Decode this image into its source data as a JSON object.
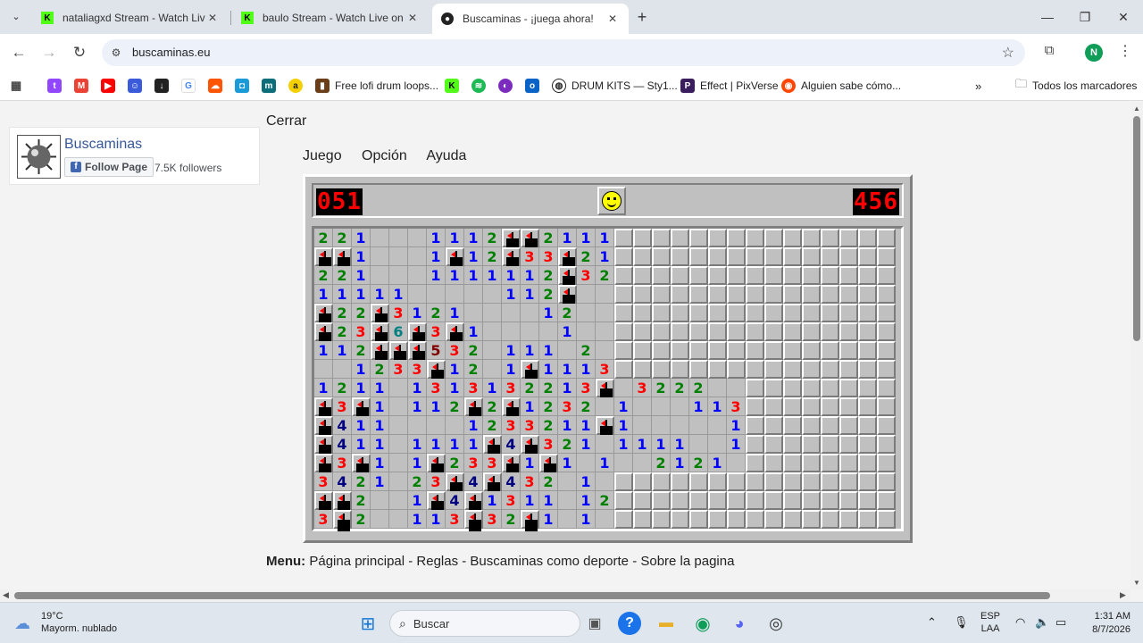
{
  "browser": {
    "tabs": [
      {
        "title": "nataliagxd Stream - Watch Live",
        "favicon": "kick-icon"
      },
      {
        "title": "baulo Stream - Watch Live on K",
        "favicon": "kick-icon"
      },
      {
        "title": "Buscaminas - ¡juega ahora!",
        "favicon": "minesweeper-icon"
      }
    ],
    "url": "buscaminas.eu",
    "profile_initial": "N",
    "bookmarks": [
      {
        "label": "",
        "icon": "apps-icon"
      },
      {
        "label": "",
        "icon": "twitch-icon",
        "color": "#9146ff"
      },
      {
        "label": "",
        "icon": "gmail-icon",
        "color": "#ea4335"
      },
      {
        "label": "",
        "icon": "youtube-icon",
        "color": "#ff0000"
      },
      {
        "label": "",
        "icon": "bot-icon",
        "color": "#3b5bdb"
      },
      {
        "label": "",
        "icon": "download-icon",
        "color": "#222222"
      },
      {
        "label": "",
        "icon": "google-icon",
        "color": "#4285f4"
      },
      {
        "label": "",
        "icon": "soundcloud-icon",
        "color": "#ff5500"
      },
      {
        "label": "",
        "icon": "app-icon",
        "color": "#1a9ad6"
      },
      {
        "label": "",
        "icon": "m-icon",
        "color": "#0b6e79"
      },
      {
        "label": "",
        "icon": "a-icon",
        "color": "#f5d000"
      },
      {
        "label": "Free lofi drum loops...",
        "icon": "lofi-icon",
        "color": "#6b3e1a"
      },
      {
        "label": "",
        "icon": "kick-icon",
        "color": "#53fc18"
      },
      {
        "label": "",
        "icon": "spotify-icon",
        "color": "#1db954"
      },
      {
        "label": "",
        "icon": "podcast-icon",
        "color": "#7b2cbf"
      },
      {
        "label": "",
        "icon": "outlook-icon",
        "color": "#0a64c8"
      },
      {
        "label": "DRUM KITS — Sty1...",
        "icon": "globe-icon",
        "color": "#222222"
      },
      {
        "label": "Effect | PixVerse",
        "icon": "pixverse-icon",
        "color": "#3a1d5c"
      },
      {
        "label": "Alguien sabe cómo...",
        "icon": "reddit-icon",
        "color": "#ff4500"
      }
    ],
    "all_bookmarks": "Todos los marcadores"
  },
  "page": {
    "fb": {
      "name": "Buscaminas",
      "follow": "Follow Page",
      "followers": "7.5K followers"
    },
    "cerrar": "Cerrar",
    "menu": [
      "Juego",
      "Opción",
      "Ayuda"
    ],
    "mines_counter": "051",
    "timer": "456",
    "board": [
      "221...1112FF2111................",
      "FF1...1F12F33F21................",
      "221...1111112F32................",
      "11111.....112F..................",
      "F22F3121....12..................",
      "F23F6F3F1....1..................",
      "112FFF532.111.2.....1...........",
      "..1233F12.1F1113................",
      "1211.1313132213F.3222...........",
      "F3F1.112F2F1232.1...113..........",
      "F411....1233211F1.....1.........",
      "F411.1111F4F321.1111..1.........",
      "F3F1.1F233F1F1.1..2121..........",
      "3421.23F4F432.1...............",
      "FF2..1F4F1311.12...............",
      "3F2..113F32F1.1................"
    ],
    "bottom_menu_label": "Menu:",
    "bottom_menu": "Página principal - Reglas - Buscaminas como deporte - Sobre la pagina"
  },
  "taskbar": {
    "temp": "19°C",
    "weather": "Mayorm. nublado",
    "search": "Buscar",
    "lang_top": "ESP",
    "lang_bottom": "LAA",
    "time": "1:31 AM",
    "date": "8/7/2026"
  }
}
